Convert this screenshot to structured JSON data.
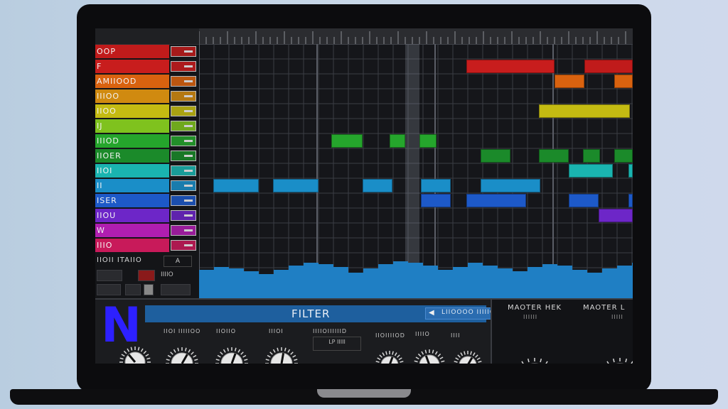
{
  "tracks": [
    {
      "name": "OOP",
      "color": "#c01b1b"
    },
    {
      "name": "F",
      "color": "#c81d1d"
    },
    {
      "name": "AMIIOOD",
      "color": "#d9620f"
    },
    {
      "name": "IIIOO",
      "color": "#d08a10"
    },
    {
      "name": "IIOO",
      "color": "#c4bb12"
    },
    {
      "name": "IJ",
      "color": "#7fc21e"
    },
    {
      "name": "IIIOD",
      "color": "#25a52c"
    },
    {
      "name": "IIOER",
      "color": "#1b8a2a"
    },
    {
      "name": "IIOI",
      "color": "#1ab4b0"
    },
    {
      "name": "II",
      "color": "#1a8ec8"
    },
    {
      "name": "ISER",
      "color": "#1d59c8"
    },
    {
      "name": "IIOU",
      "color": "#6d26c8"
    },
    {
      "name": "W",
      "color": "#b01eb0"
    },
    {
      "name": "IIIO",
      "color": "#c81a5a"
    }
  ],
  "track_controls": {
    "label": "IIOII ITAIIO",
    "value": "A",
    "small_label": "IIIIO"
  },
  "filter": {
    "title": "FILTER",
    "preset": "LIIOOOO IIIIIOO"
  },
  "knobs": [
    {
      "label": "IIOI IIIIIOO"
    },
    {
      "label": "IIOIIO"
    },
    {
      "label": "IIIOI"
    },
    {
      "label": "IIOIIIIOD"
    },
    {
      "label": "IIIIO"
    },
    {
      "label": "IIII"
    },
    {
      "label": "IIIIIOO"
    }
  ],
  "cutoff": {
    "label": "IIIIOIIIIIID",
    "value": "LP IIIII"
  },
  "master": {
    "left_label": "MAOTER HEK",
    "left_sub": "IIIIII",
    "right_label": "MAOTER L",
    "right_sub": "IIIII"
  },
  "accent_colors": {
    "filter_bar": "#1e5f9e",
    "logo": "#2d20ff"
  }
}
